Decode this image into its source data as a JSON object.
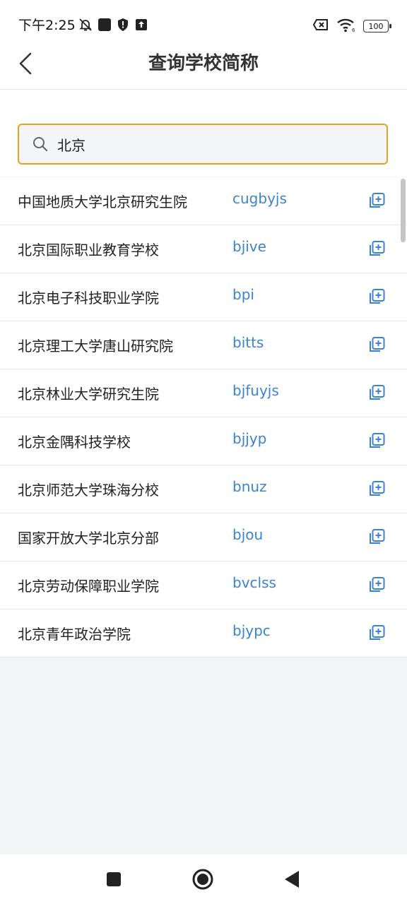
{
  "status_bar": {
    "time": "下午2:25",
    "battery": "100"
  },
  "header": {
    "title": "查询学校简称"
  },
  "search": {
    "value": "北京"
  },
  "colors": {
    "accent_border": "#e6a322",
    "abbr_blue": "#3b83d1"
  },
  "results": [
    {
      "name": "中国地质大学北京研究生院",
      "abbr": "cugbyjs"
    },
    {
      "name": "北京国际职业教育学校",
      "abbr": "bjive"
    },
    {
      "name": "北京电子科技职业学院",
      "abbr": "bpi"
    },
    {
      "name": "北京理工大学唐山研究院",
      "abbr": "bitts"
    },
    {
      "name": "北京林业大学研究生院",
      "abbr": "bjfuyjs"
    },
    {
      "name": "北京金隅科技学校",
      "abbr": "bjjyp"
    },
    {
      "name": "北京师范大学珠海分校",
      "abbr": "bnuz"
    },
    {
      "name": "国家开放大学北京分部",
      "abbr": "bjou"
    },
    {
      "name": "北京劳动保障职业学院",
      "abbr": "bvclss"
    },
    {
      "name": "北京青年政治学院",
      "abbr": "bjypc"
    }
  ]
}
